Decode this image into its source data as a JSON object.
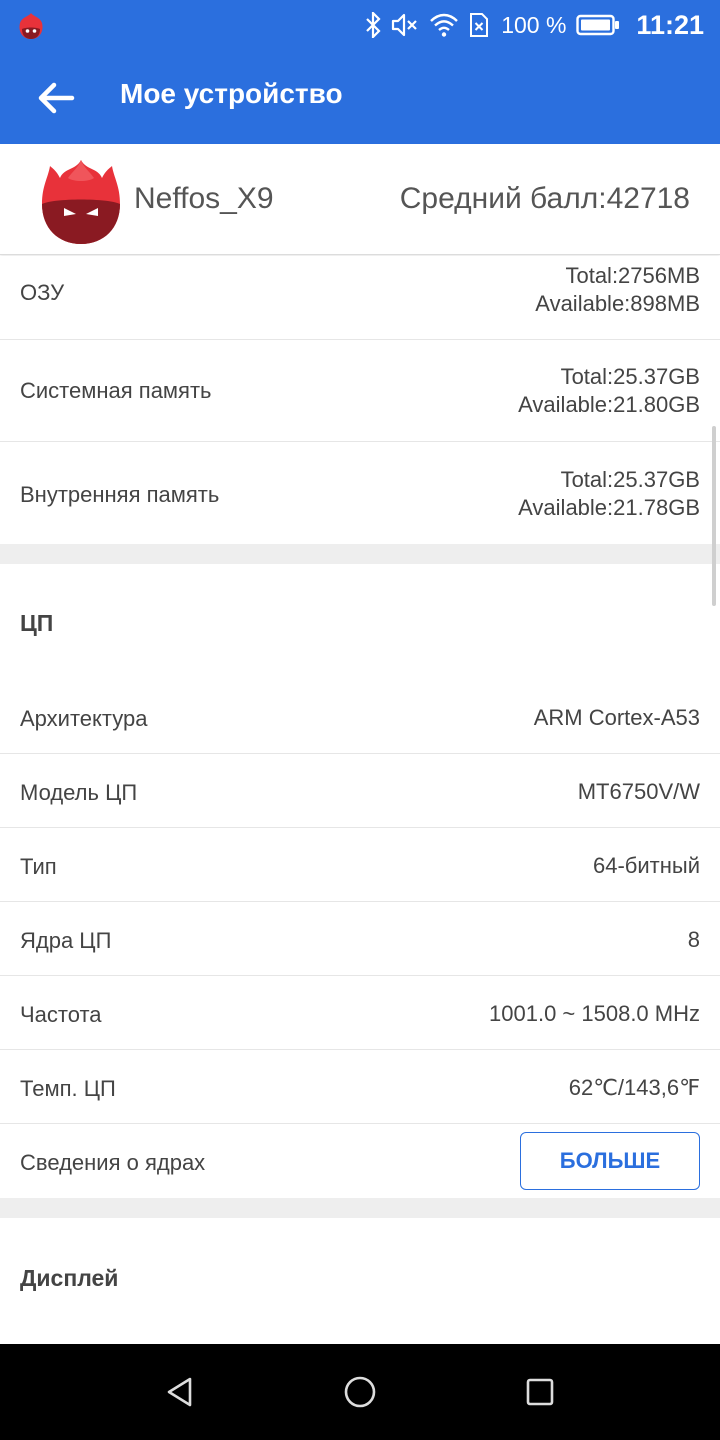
{
  "status_bar": {
    "battery_percent": "100 %",
    "time": "11:21",
    "icons": [
      "antutu-notification-icon",
      "bluetooth-icon",
      "mute-icon",
      "wifi-icon",
      "no-sim-icon",
      "battery-icon"
    ]
  },
  "app_bar": {
    "title": "Мое устройство",
    "back_icon": "arrow-left-icon"
  },
  "device": {
    "name": "Neffos_X9",
    "score_label": "Средний балл:42718"
  },
  "memory_rows": [
    {
      "label": "ОЗУ",
      "total": "Total:2756MB",
      "available": "Available:898MB"
    },
    {
      "label": "Системная память",
      "total": "Total:25.37GB",
      "available": "Available:21.80GB"
    },
    {
      "label": "Внутренняя память",
      "total": "Total:25.37GB",
      "available": "Available:21.78GB"
    }
  ],
  "cpu": {
    "section_title": "ЦП",
    "rows": [
      {
        "label": "Архитектура",
        "value": "ARM Cortex-A53"
      },
      {
        "label": "Модель ЦП",
        "value": "MT6750V/W"
      },
      {
        "label": "Тип",
        "value": "64-битный"
      },
      {
        "label": "Ядра ЦП",
        "value": "8"
      },
      {
        "label": "Частота",
        "value": "1001.0 ~ 1508.0 MHz"
      },
      {
        "label": "Темп. ЦП",
        "value": "62℃/143,6℉"
      }
    ],
    "cores_label": "Сведения о ядрах",
    "more_button": "БОЛЬШЕ"
  },
  "display": {
    "section_title": "Дисплей"
  },
  "colors": {
    "accent": "#2b6fde",
    "divider": "#e6e6e6",
    "section_gap": "#eeeeee",
    "logo_red": "#e8323a",
    "logo_dark": "#8a1a22"
  },
  "nav_bar": {
    "icons": [
      "back-triangle-icon",
      "home-circle-icon",
      "recents-square-icon"
    ]
  }
}
